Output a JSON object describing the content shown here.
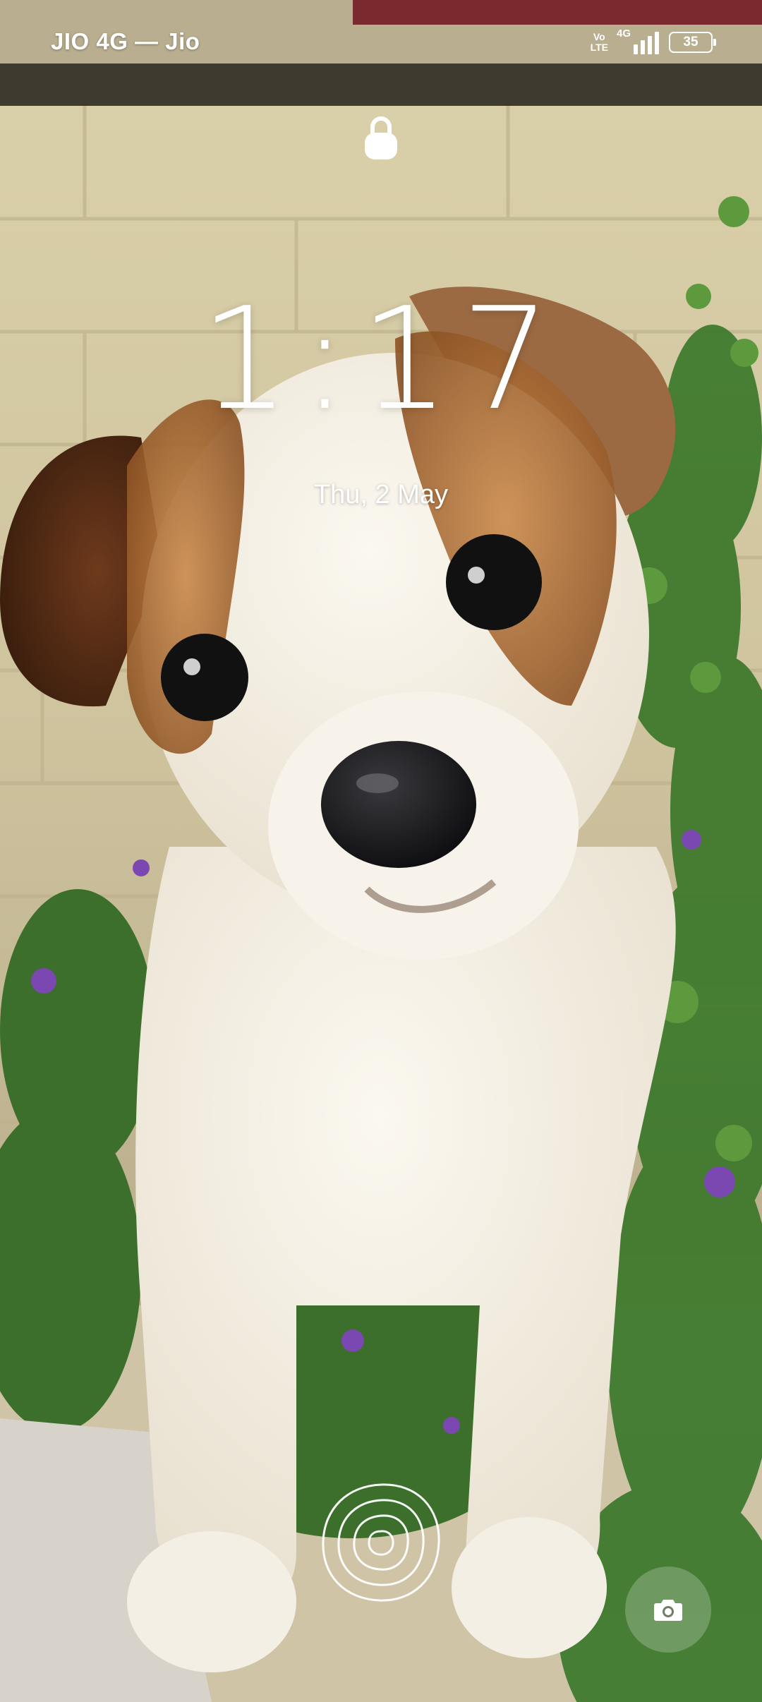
{
  "status_bar": {
    "carrier": "JIO 4G — Jio",
    "volte_top": "Vo",
    "volte_bottom": "LTE",
    "network_type": "4G",
    "battery_level": "35"
  },
  "lock_screen": {
    "time": "1:17",
    "date": "Thu, 2 May"
  },
  "icons": {
    "lock": "lock-icon",
    "fingerprint": "fingerprint-icon",
    "camera": "camera-icon",
    "signal": "signal-icon",
    "battery": "battery-icon"
  },
  "colors": {
    "text": "#ffffff"
  }
}
